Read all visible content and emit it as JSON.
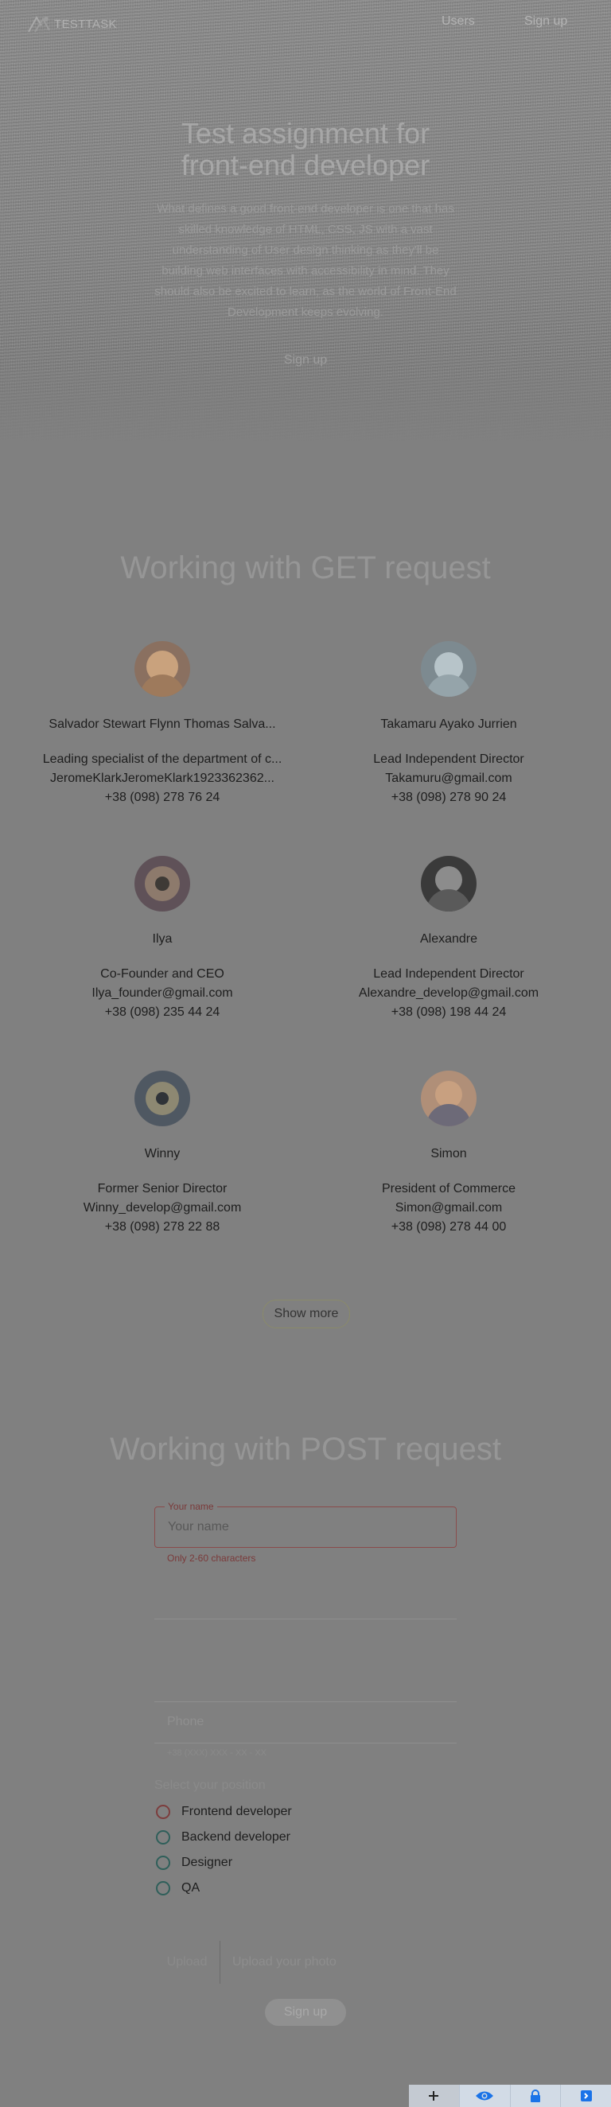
{
  "nav": {
    "logo_text": "TESTTASK",
    "users_label": "Users",
    "signup_label": "Sign up"
  },
  "hero": {
    "title": "Test assignment for front-end developer",
    "text": "What defines a good front-end developer is one that has skilled knowledge of HTML, CSS, JS with a vast understanding of User design thinking as they'll be building web interfaces with accessibility in mind. They should also be excited to learn, as the world of Front-End Development keeps evolving.",
    "signup_label": "Sign up"
  },
  "get_section": {
    "title": "Working with GET request",
    "users": [
      {
        "name": "Salvador Stewart Flynn Thomas Salva...",
        "position": "Leading specialist of the department of c...",
        "email": "JeromeKlarkJeromeKlark1923362362...",
        "phone": "+38 (098) 278 76 24",
        "avatar_color": "#b98f6a"
      },
      {
        "name": "Takamaru Ayako Jurrien",
        "position": "Lead Independent Director",
        "email": "Takamuru@gmail.com",
        "phone": "+38 (098) 278 90 24",
        "avatar_color": "#8ea0a8"
      },
      {
        "name": "Ilya",
        "position": "Co-Founder and CEO",
        "email": "Ilya_founder@gmail.com",
        "phone": "+38 (098) 235 44 24",
        "avatar_color": "#7b6a70"
      },
      {
        "name": "Alexandre",
        "position": "Lead Independent Director",
        "email": "Alexandre_develop@gmail.com",
        "phone": "+38 (098) 198 44 24",
        "avatar_color": "#4a4a4a"
      },
      {
        "name": "Winny",
        "position": "Former Senior Director",
        "email": "Winny_develop@gmail.com",
        "phone": "+38 (098) 278 22 88",
        "avatar_color": "#5d6670"
      },
      {
        "name": "Simon",
        "position": "President of Commerce",
        "email": "Simon@gmail.com",
        "phone": "+38 (098) 278 44 00",
        "avatar_color": "#a8846c"
      }
    ],
    "show_more_label": "Show more"
  },
  "post_section": {
    "title": "Working with POST request",
    "name_field": {
      "legend": "Your name",
      "placeholder": "Your name",
      "helper": "Only 2-60 characters"
    },
    "phone_field": {
      "placeholder": "Phone",
      "helper": "+38 (XXX) XXX - XX - XX"
    },
    "position_label": "Select your position",
    "positions": [
      "Frontend developer",
      "Backend developer",
      "Designer",
      "QA"
    ],
    "upload_button": "Upload",
    "upload_placeholder": "Upload your photo",
    "submit_label": "Sign up"
  },
  "colors": {
    "background": "#808080",
    "error": "#7a3a3a",
    "radio": "#2f5f5a",
    "extension_bar": "#d2dbe6",
    "extension_icon": "#1a73e8"
  },
  "extension_bar": {
    "icons": [
      "crosshair-icon",
      "eye-icon",
      "lock-icon",
      "exit-icon"
    ]
  }
}
